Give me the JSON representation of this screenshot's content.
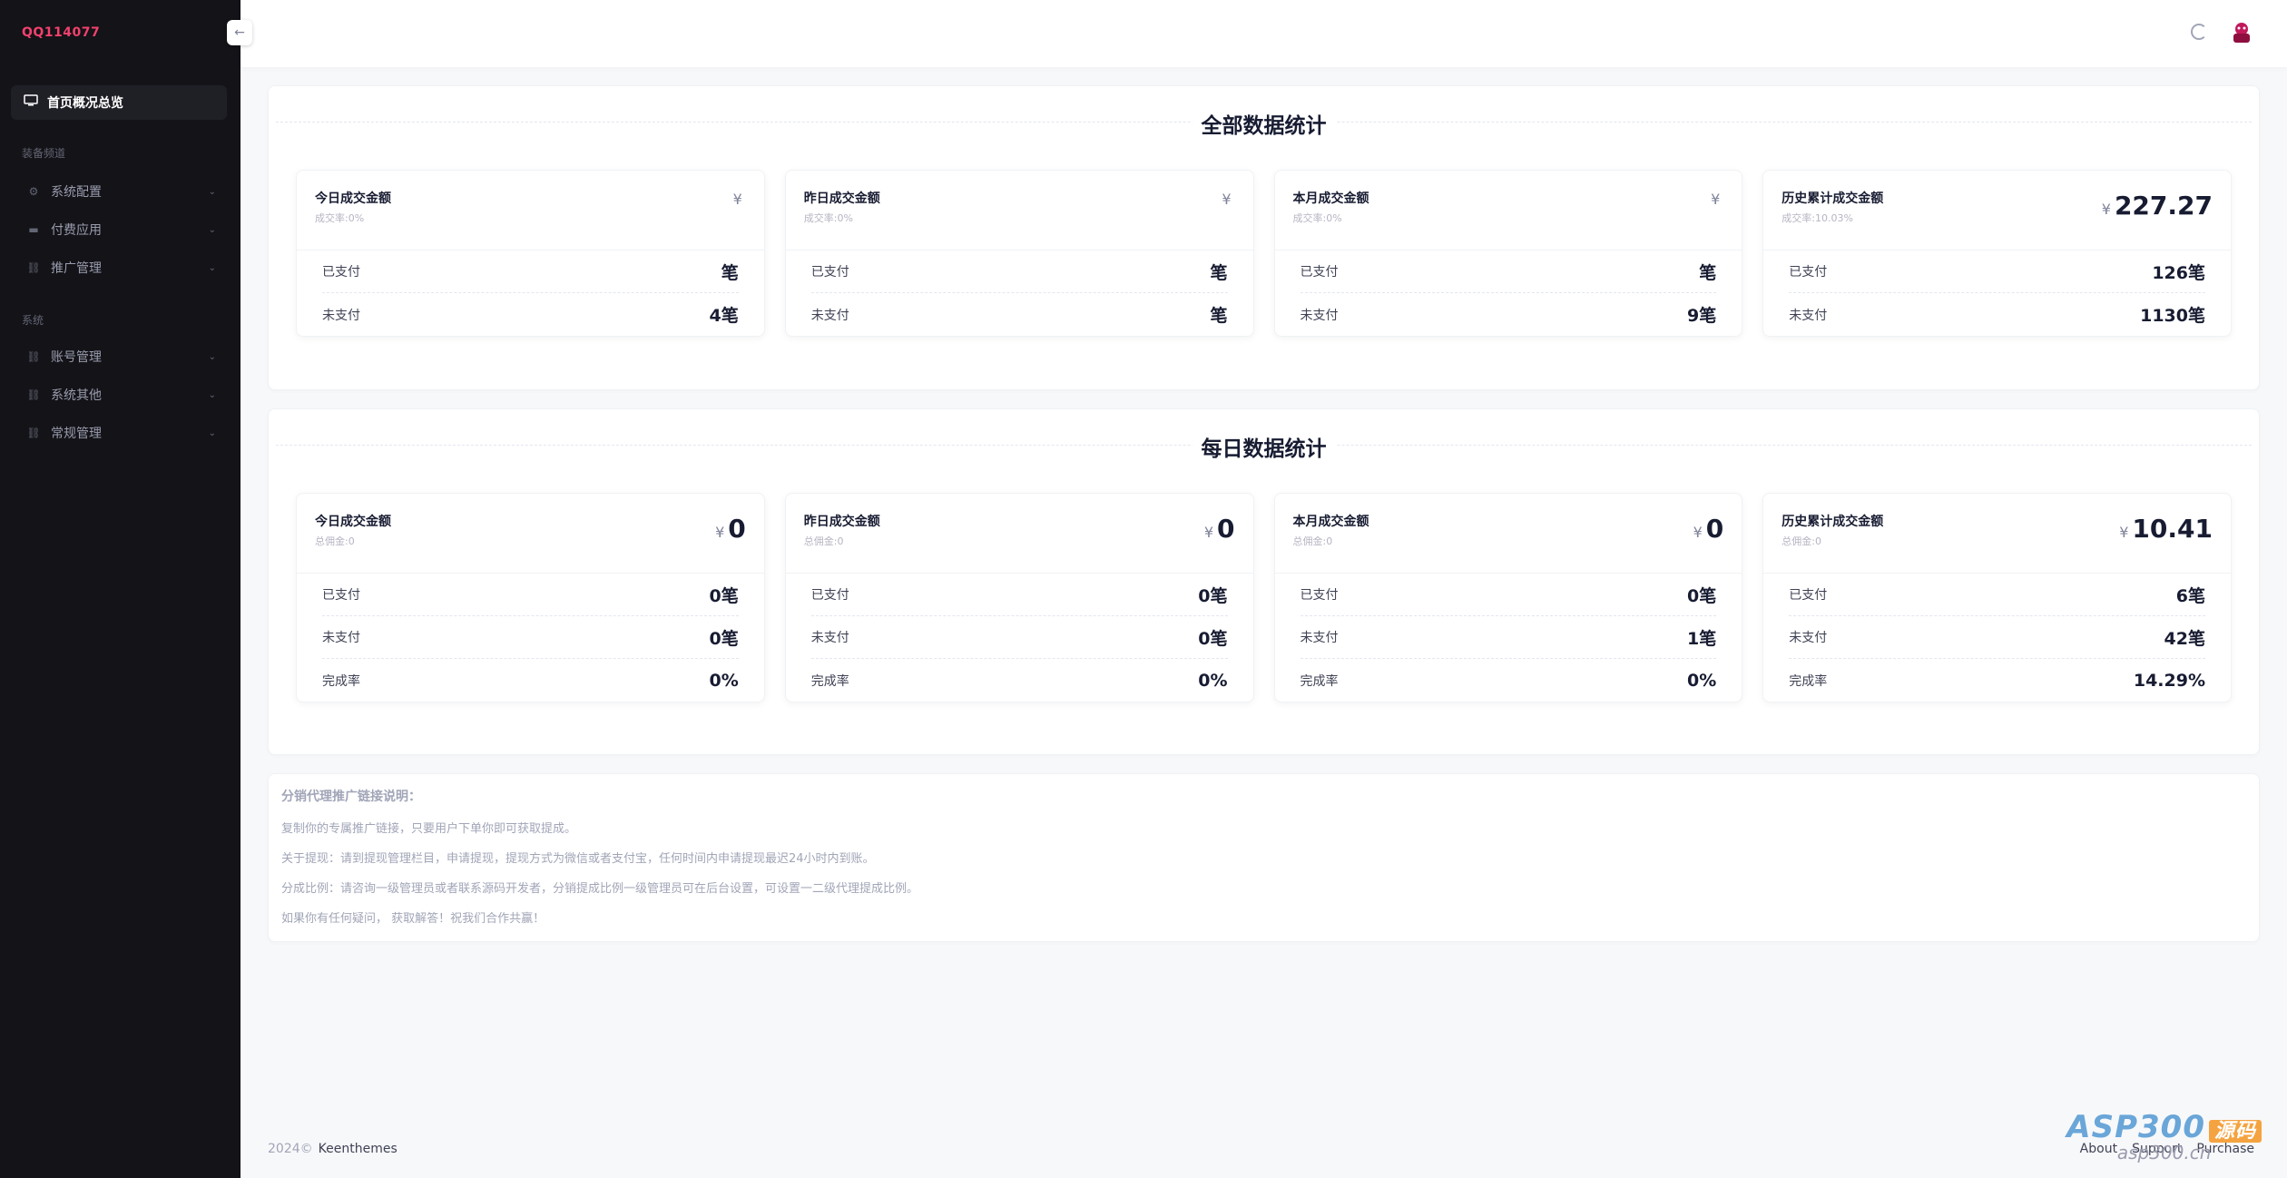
{
  "brand": "QQ114077",
  "sidebar": {
    "toggle_icon": "arrow-left",
    "active": {
      "label": "首页概况总览",
      "icon": "monitor-icon"
    },
    "section1": "装备频道",
    "group1": [
      {
        "label": "系统配置",
        "icon": "gear-icon"
      },
      {
        "label": "付费应用",
        "icon": "card-icon"
      },
      {
        "label": "推广管理",
        "icon": "link-icon"
      }
    ],
    "section2": "系统",
    "group2": [
      {
        "label": "账号管理",
        "icon": "link-icon"
      },
      {
        "label": "系统其他",
        "icon": "link-icon"
      },
      {
        "label": "常规管理",
        "icon": "link-icon"
      }
    ]
  },
  "currency": "¥",
  "unit_label": "笔",
  "all_stats": {
    "title": "全部数据统计",
    "cards": [
      {
        "title": "今日成交金额",
        "sub": "成交率:0%",
        "amount": "",
        "rows": [
          {
            "k": "已支付",
            "v": "笔"
          },
          {
            "k": "未支付",
            "v": "4笔"
          }
        ]
      },
      {
        "title": "昨日成交金额",
        "sub": "成交率:0%",
        "amount": "",
        "rows": [
          {
            "k": "已支付",
            "v": "笔"
          },
          {
            "k": "未支付",
            "v": "笔"
          }
        ]
      },
      {
        "title": "本月成交金额",
        "sub": "成交率:0%",
        "amount": "",
        "rows": [
          {
            "k": "已支付",
            "v": "笔"
          },
          {
            "k": "未支付",
            "v": "9笔"
          }
        ]
      },
      {
        "title": "历史累计成交金额",
        "sub": "成交率:10.03%",
        "amount": "227.27",
        "rows": [
          {
            "k": "已支付",
            "v": "126笔"
          },
          {
            "k": "未支付",
            "v": "1130笔"
          }
        ]
      }
    ]
  },
  "daily_stats": {
    "title": "每日数据统计",
    "cards": [
      {
        "title": "今日成交金额",
        "sub": "总佣金:0",
        "amount": "0",
        "rows": [
          {
            "k": "已支付",
            "v": "0笔"
          },
          {
            "k": "未支付",
            "v": "0笔"
          },
          {
            "k": "完成率",
            "v": "0%"
          }
        ]
      },
      {
        "title": "昨日成交金额",
        "sub": "总佣金:0",
        "amount": "0",
        "rows": [
          {
            "k": "已支付",
            "v": "0笔"
          },
          {
            "k": "未支付",
            "v": "0笔"
          },
          {
            "k": "完成率",
            "v": "0%"
          }
        ]
      },
      {
        "title": "本月成交金额",
        "sub": "总佣金:0",
        "amount": "0",
        "rows": [
          {
            "k": "已支付",
            "v": "0笔"
          },
          {
            "k": "未支付",
            "v": "1笔"
          },
          {
            "k": "完成率",
            "v": "0%"
          }
        ]
      },
      {
        "title": "历史累计成交金额",
        "sub": "总佣金:0",
        "amount": "10.41",
        "rows": [
          {
            "k": "已支付",
            "v": "6笔"
          },
          {
            "k": "未支付",
            "v": "42笔"
          },
          {
            "k": "完成率",
            "v": "14.29%"
          }
        ]
      }
    ]
  },
  "notes": {
    "title": "分销代理推广链接说明：",
    "lines": [
      "复制你的专属推广链接，只要用户下单你即可获取提成。",
      "关于提现：请到提现管理栏目，申请提现，提现方式为微信或者支付宝，任何时间内申请提现最迟24小时内到账。",
      "分成比例：请咨询一级管理员或者联系源码开发者，分销提成比例一级管理员可在后台设置，可设置一二级代理提成比例。",
      "如果你有任何疑问， 获取解答！祝我们合作共赢！"
    ]
  },
  "footer": {
    "year": "2024©",
    "brand": "Keenthemes",
    "links": [
      "About",
      "Support",
      "Purchase"
    ]
  },
  "watermark": {
    "main": "ASP300",
    "tag": "源码",
    "domain": "asp300.cn"
  }
}
